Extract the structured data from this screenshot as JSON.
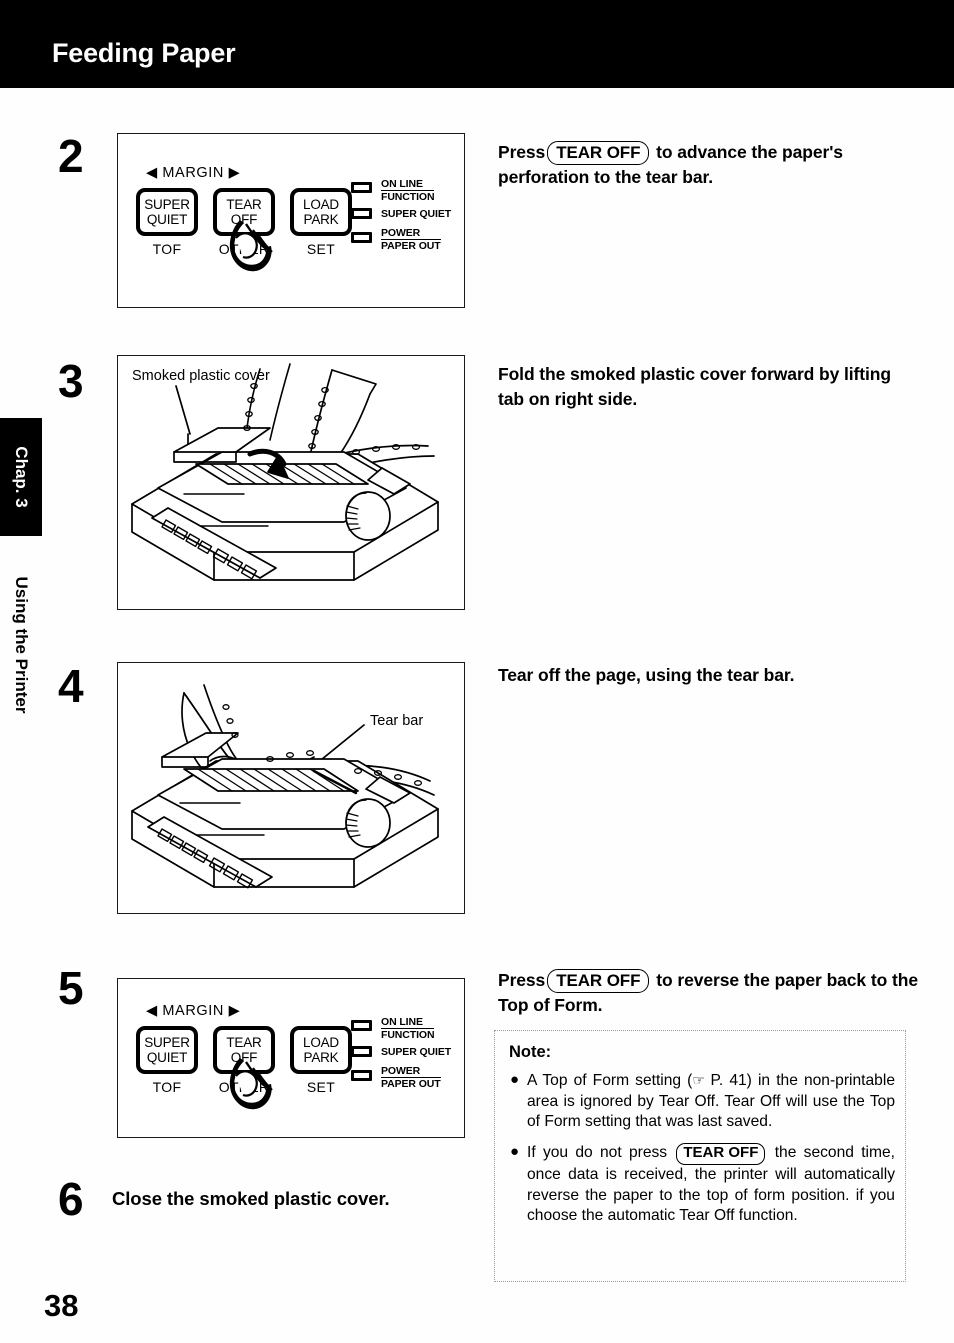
{
  "header": {
    "title": "Feeding Paper"
  },
  "sidebar": {
    "chapter_tab": "Chap. 3",
    "chapter_name": "Using the Printer"
  },
  "page_number": "38",
  "control_panel": {
    "margin_label": "◀ MARGIN ▶",
    "buttons": [
      {
        "line1": "SUPER",
        "line2": "QUIET",
        "sub": "TOF"
      },
      {
        "line1": "TEAR",
        "line2": "OFF",
        "sub": "OTHER"
      },
      {
        "line1": "LOAD",
        "line2": "PARK",
        "sub": "SET"
      }
    ],
    "leds": [
      {
        "top": "ON LINE",
        "bottom": "FUNCTION",
        "underlined": true
      },
      {
        "top": "SUPER QUIET",
        "bottom": "",
        "underlined": false
      },
      {
        "top": "POWER",
        "bottom": "PAPER OUT",
        "underlined": true
      }
    ]
  },
  "steps": [
    {
      "number": "2",
      "figure": "printer-control-panel",
      "text_lead": "Press",
      "keycap": "TEAR OFF",
      "text_rest": "to advance the paper's perforation to the tear bar."
    },
    {
      "number": "3",
      "figure": "printer-smoked-cover",
      "figure_label": "Smoked plastic cover",
      "text": "Fold the smoked plastic cover forward by lifting tab on right side."
    },
    {
      "number": "4",
      "figure": "printer-tear-bar",
      "figure_label": "Tear bar",
      "text": "Tear off the page, using the tear bar."
    },
    {
      "number": "5",
      "figure": "printer-control-panel",
      "text_lead": "Press",
      "keycap": "TEAR OFF",
      "text_rest": "to reverse the paper back to the Top of Form."
    },
    {
      "number": "6",
      "text": "Close the smoked plastic cover."
    }
  ],
  "note": {
    "title": "Note:",
    "bullets": [
      {
        "part1": "A Top of Form setting (",
        "icon": "pointing-hand",
        "part2": " P. 41) in the non-printable area is ignored by Tear Off. Tear Off will use the Top of Form setting that was last saved."
      },
      {
        "part1": "If you do not press",
        "keycap": "TEAR OFF",
        "part2": "the second time, once data is received, the printer will automatically reverse the paper to the top of form position. if you choose the automatic Tear Off function."
      }
    ]
  },
  "colors": {
    "ink": "#000000",
    "paper": "#fefefe",
    "header_band": "#000000",
    "note_border": "#9a9a9a"
  }
}
